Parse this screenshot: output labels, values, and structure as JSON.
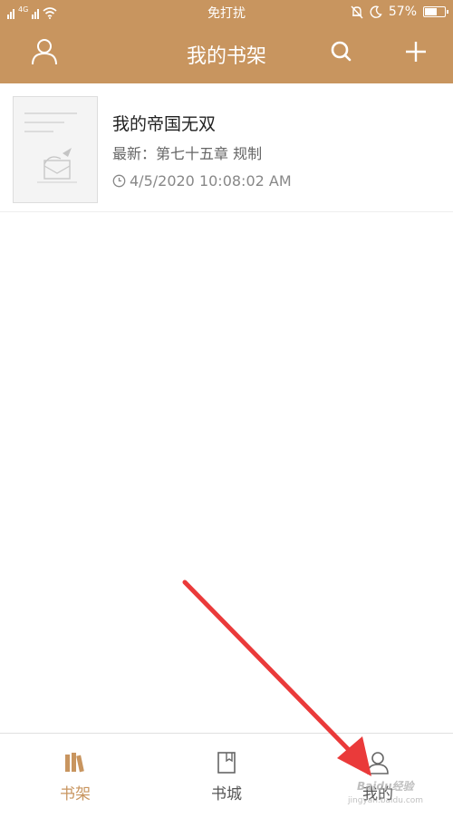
{
  "status_bar": {
    "signal": "5il",
    "network": "4G",
    "center_text": "免打扰",
    "battery_text": "57%",
    "battery_level": 0.57,
    "icons": [
      "signal-icon",
      "wifi-icon",
      "bell-off-icon",
      "moon-icon",
      "battery-icon"
    ]
  },
  "nav": {
    "title": "我的书架",
    "left_icon": "user-icon",
    "search_icon": "search-icon",
    "add_icon": "plus-icon"
  },
  "book": {
    "title": "我的帝国无双",
    "latest_label": "最新：",
    "latest_chapter": "第七十五章 规制",
    "time": "4/5/2020 10:08:02 AM",
    "time_icon": "clock-icon"
  },
  "tabs": [
    {
      "label": "书架",
      "icon": "books-icon",
      "active": true
    },
    {
      "label": "书城",
      "icon": "store-icon",
      "active": false
    },
    {
      "label": "我的",
      "icon": "profile-icon",
      "active": false
    }
  ],
  "colors": {
    "accent": "#c8955f",
    "annotation_arrow": "#ea3a3a"
  },
  "watermark": {
    "brand": "Baidu经验",
    "url": "jingyan.baidu.com"
  }
}
